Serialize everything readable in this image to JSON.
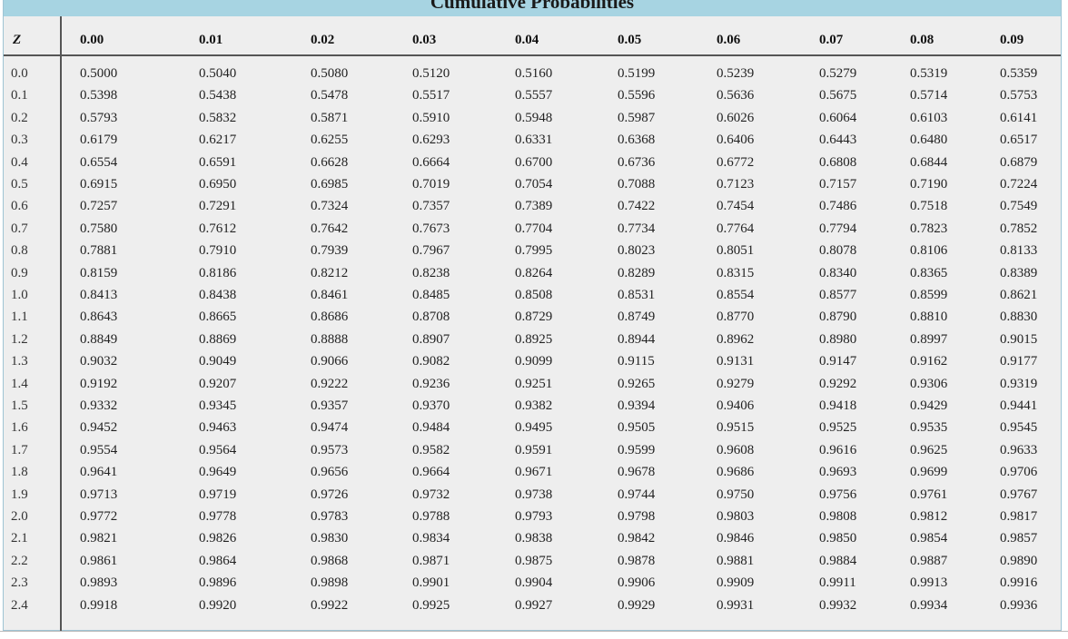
{
  "title": "Cumulative Probabilities",
  "header": {
    "z_label": "Z",
    "columns": [
      "0.00",
      "0.01",
      "0.02",
      "0.03",
      "0.04",
      "0.05",
      "0.06",
      "0.07",
      "0.08",
      "0.09"
    ]
  },
  "rows": [
    {
      "z": "0.0",
      "values": [
        "0.5000",
        "0.5040",
        "0.5080",
        "0.5120",
        "0.5160",
        "0.5199",
        "0.5239",
        "0.5279",
        "0.5319",
        "0.5359"
      ]
    },
    {
      "z": "0.1",
      "values": [
        "0.5398",
        "0.5438",
        "0.5478",
        "0.5517",
        "0.5557",
        "0.5596",
        "0.5636",
        "0.5675",
        "0.5714",
        "0.5753"
      ]
    },
    {
      "z": "0.2",
      "values": [
        "0.5793",
        "0.5832",
        "0.5871",
        "0.5910",
        "0.5948",
        "0.5987",
        "0.6026",
        "0.6064",
        "0.6103",
        "0.6141"
      ]
    },
    {
      "z": "0.3",
      "values": [
        "0.6179",
        "0.6217",
        "0.6255",
        "0.6293",
        "0.6331",
        "0.6368",
        "0.6406",
        "0.6443",
        "0.6480",
        "0.6517"
      ]
    },
    {
      "z": "0.4",
      "values": [
        "0.6554",
        "0.6591",
        "0.6628",
        "0.6664",
        "0.6700",
        "0.6736",
        "0.6772",
        "0.6808",
        "0.6844",
        "0.6879"
      ]
    },
    {
      "z": "0.5",
      "values": [
        "0.6915",
        "0.6950",
        "0.6985",
        "0.7019",
        "0.7054",
        "0.7088",
        "0.7123",
        "0.7157",
        "0.7190",
        "0.7224"
      ]
    },
    {
      "z": "0.6",
      "values": [
        "0.7257",
        "0.7291",
        "0.7324",
        "0.7357",
        "0.7389",
        "0.7422",
        "0.7454",
        "0.7486",
        "0.7518",
        "0.7549"
      ]
    },
    {
      "z": "0.7",
      "values": [
        "0.7580",
        "0.7612",
        "0.7642",
        "0.7673",
        "0.7704",
        "0.7734",
        "0.7764",
        "0.7794",
        "0.7823",
        "0.7852"
      ]
    },
    {
      "z": "0.8",
      "values": [
        "0.7881",
        "0.7910",
        "0.7939",
        "0.7967",
        "0.7995",
        "0.8023",
        "0.8051",
        "0.8078",
        "0.8106",
        "0.8133"
      ]
    },
    {
      "z": "0.9",
      "values": [
        "0.8159",
        "0.8186",
        "0.8212",
        "0.8238",
        "0.8264",
        "0.8289",
        "0.8315",
        "0.8340",
        "0.8365",
        "0.8389"
      ]
    },
    {
      "z": "1.0",
      "values": [
        "0.8413",
        "0.8438",
        "0.8461",
        "0.8485",
        "0.8508",
        "0.8531",
        "0.8554",
        "0.8577",
        "0.8599",
        "0.8621"
      ]
    },
    {
      "z": "1.1",
      "values": [
        "0.8643",
        "0.8665",
        "0.8686",
        "0.8708",
        "0.8729",
        "0.8749",
        "0.8770",
        "0.8790",
        "0.8810",
        "0.8830"
      ]
    },
    {
      "z": "1.2",
      "values": [
        "0.8849",
        "0.8869",
        "0.8888",
        "0.8907",
        "0.8925",
        "0.8944",
        "0.8962",
        "0.8980",
        "0.8997",
        "0.9015"
      ]
    },
    {
      "z": "1.3",
      "values": [
        "0.9032",
        "0.9049",
        "0.9066",
        "0.9082",
        "0.9099",
        "0.9115",
        "0.9131",
        "0.9147",
        "0.9162",
        "0.9177"
      ]
    },
    {
      "z": "1.4",
      "values": [
        "0.9192",
        "0.9207",
        "0.9222",
        "0.9236",
        "0.9251",
        "0.9265",
        "0.9279",
        "0.9292",
        "0.9306",
        "0.9319"
      ]
    },
    {
      "z": "1.5",
      "values": [
        "0.9332",
        "0.9345",
        "0.9357",
        "0.9370",
        "0.9382",
        "0.9394",
        "0.9406",
        "0.9418",
        "0.9429",
        "0.9441"
      ]
    },
    {
      "z": "1.6",
      "values": [
        "0.9452",
        "0.9463",
        "0.9474",
        "0.9484",
        "0.9495",
        "0.9505",
        "0.9515",
        "0.9525",
        "0.9535",
        "0.9545"
      ]
    },
    {
      "z": "1.7",
      "values": [
        "0.9554",
        "0.9564",
        "0.9573",
        "0.9582",
        "0.9591",
        "0.9599",
        "0.9608",
        "0.9616",
        "0.9625",
        "0.9633"
      ]
    },
    {
      "z": "1.8",
      "values": [
        "0.9641",
        "0.9649",
        "0.9656",
        "0.9664",
        "0.9671",
        "0.9678",
        "0.9686",
        "0.9693",
        "0.9699",
        "0.9706"
      ]
    },
    {
      "z": "1.9",
      "values": [
        "0.9713",
        "0.9719",
        "0.9726",
        "0.9732",
        "0.9738",
        "0.9744",
        "0.9750",
        "0.9756",
        "0.9761",
        "0.9767"
      ]
    },
    {
      "z": "2.0",
      "values": [
        "0.9772",
        "0.9778",
        "0.9783",
        "0.9788",
        "0.9793",
        "0.9798",
        "0.9803",
        "0.9808",
        "0.9812",
        "0.9817"
      ]
    },
    {
      "z": "2.1",
      "values": [
        "0.9821",
        "0.9826",
        "0.9830",
        "0.9834",
        "0.9838",
        "0.9842",
        "0.9846",
        "0.9850",
        "0.9854",
        "0.9857"
      ]
    },
    {
      "z": "2.2",
      "values": [
        "0.9861",
        "0.9864",
        "0.9868",
        "0.9871",
        "0.9875",
        "0.9878",
        "0.9881",
        "0.9884",
        "0.9887",
        "0.9890"
      ]
    },
    {
      "z": "2.3",
      "values": [
        "0.9893",
        "0.9896",
        "0.9898",
        "0.9901",
        "0.9904",
        "0.9906",
        "0.9909",
        "0.9911",
        "0.9913",
        "0.9916"
      ]
    },
    {
      "z": "2.4",
      "values": [
        "0.9918",
        "0.9920",
        "0.9922",
        "0.9925",
        "0.9927",
        "0.9929",
        "0.9931",
        "0.9932",
        "0.9934",
        "0.9936"
      ]
    }
  ]
}
